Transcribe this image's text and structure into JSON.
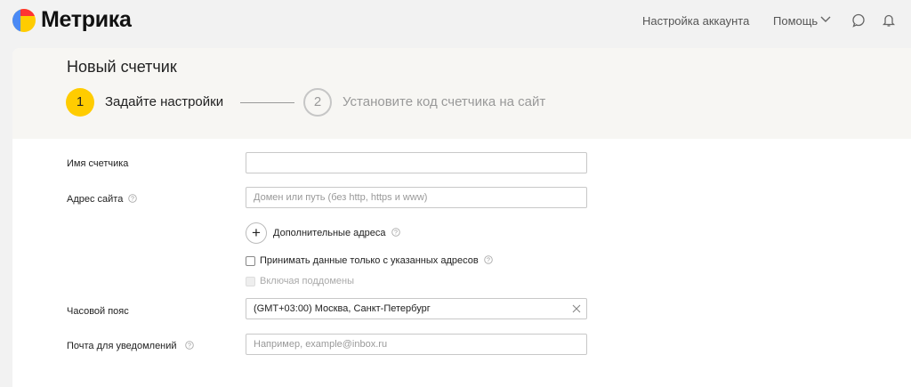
{
  "header": {
    "brand": "Метрика",
    "account_settings": "Настройка аккаунта",
    "help": "Помощь"
  },
  "page": {
    "title": "Новый счетчик",
    "steps": [
      {
        "number": "1",
        "label": "Задайте настройки",
        "active": true
      },
      {
        "number": "2",
        "label": "Установите код счетчика на сайт",
        "active": false
      }
    ]
  },
  "form": {
    "counter_name": {
      "label": "Имя счетчика",
      "value": ""
    },
    "site_address": {
      "label": "Адрес сайта",
      "placeholder": "Домен или путь (без http, https и www)"
    },
    "extra_addresses": {
      "label": "Дополнительные адреса"
    },
    "only_listed": {
      "label": "Принимать данные только с указанных адресов",
      "checked": false
    },
    "subdomains": {
      "label": "Включая поддомены",
      "checked": false,
      "disabled": true
    },
    "timezone": {
      "label": "Часовой пояс",
      "value": "(GMT+03:00) Москва, Санкт-Петербург"
    },
    "email": {
      "label": "Почта для уведомлений",
      "placeholder": "Например, example@inbox.ru"
    }
  },
  "colors": {
    "accent": "#ffcc00",
    "header_bg": "#f7f6f3",
    "page_bg": "#f2f2f2"
  }
}
